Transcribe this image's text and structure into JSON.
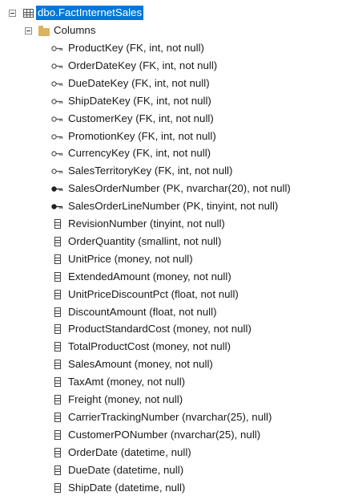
{
  "tree": {
    "table_label": "dbo.FactInternetSales",
    "columns_folder_label": "Columns",
    "columns": [
      {
        "label": "ProductKey (FK, int, not null)",
        "icon": "fk-key-icon"
      },
      {
        "label": "OrderDateKey (FK, int, not null)",
        "icon": "fk-key-icon"
      },
      {
        "label": "DueDateKey (FK, int, not null)",
        "icon": "fk-key-icon"
      },
      {
        "label": "ShipDateKey (FK, int, not null)",
        "icon": "fk-key-icon"
      },
      {
        "label": "CustomerKey (FK, int, not null)",
        "icon": "fk-key-icon"
      },
      {
        "label": "PromotionKey (FK, int, not null)",
        "icon": "fk-key-icon"
      },
      {
        "label": "CurrencyKey (FK, int, not null)",
        "icon": "fk-key-icon"
      },
      {
        "label": "SalesTerritoryKey (FK, int, not null)",
        "icon": "fk-key-icon"
      },
      {
        "label": "SalesOrderNumber (PK, nvarchar(20), not null)",
        "icon": "pk-key-icon"
      },
      {
        "label": "SalesOrderLineNumber (PK, tinyint, not null)",
        "icon": "pk-key-icon"
      },
      {
        "label": "RevisionNumber (tinyint, not null)",
        "icon": "column-icon"
      },
      {
        "label": "OrderQuantity (smallint, not null)",
        "icon": "column-icon"
      },
      {
        "label": "UnitPrice (money, not null)",
        "icon": "column-icon"
      },
      {
        "label": "ExtendedAmount (money, not null)",
        "icon": "column-icon"
      },
      {
        "label": "UnitPriceDiscountPct (float, not null)",
        "icon": "column-icon"
      },
      {
        "label": "DiscountAmount (float, not null)",
        "icon": "column-icon"
      },
      {
        "label": "ProductStandardCost (money, not null)",
        "icon": "column-icon"
      },
      {
        "label": "TotalProductCost (money, not null)",
        "icon": "column-icon"
      },
      {
        "label": "SalesAmount (money, not null)",
        "icon": "column-icon"
      },
      {
        "label": "TaxAmt (money, not null)",
        "icon": "column-icon"
      },
      {
        "label": "Freight (money, not null)",
        "icon": "column-icon"
      },
      {
        "label": "CarrierTrackingNumber (nvarchar(25), null)",
        "icon": "column-icon"
      },
      {
        "label": "CustomerPONumber (nvarchar(25), null)",
        "icon": "column-icon"
      },
      {
        "label": "OrderDate (datetime, null)",
        "icon": "column-icon"
      },
      {
        "label": "DueDate (datetime, null)",
        "icon": "column-icon"
      },
      {
        "label": "ShipDate (datetime, null)",
        "icon": "column-icon"
      }
    ]
  },
  "colors": {
    "selection": "#0078d7",
    "folder": "#dcb35c",
    "text": "#1a1a1a"
  }
}
